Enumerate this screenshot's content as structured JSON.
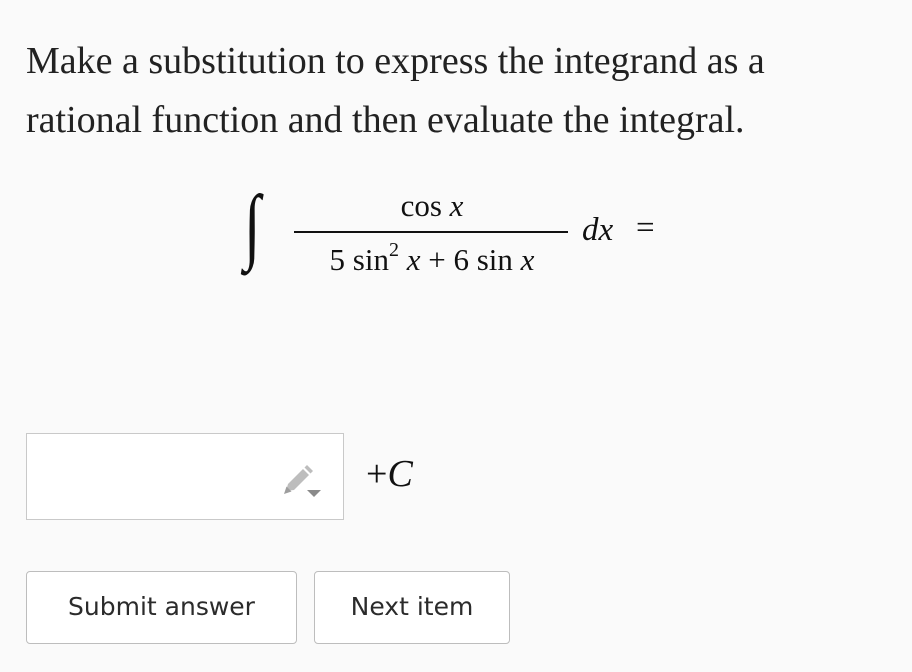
{
  "question": {
    "line1": "Make a substitution to express the integrand as a",
    "line2": "rational function and then evaluate the integral."
  },
  "math": {
    "integral_sign": "∫",
    "numerator": {
      "fn": "cos",
      "var": "x"
    },
    "denominator": {
      "coef1": "5",
      "fn1": "sin",
      "exponent": "2",
      "var1": "x",
      "plus": "+",
      "coef2": "6",
      "fn2": "sin",
      "var2": "x"
    },
    "differential": "dx",
    "equals": "="
  },
  "answer": {
    "value": "",
    "placeholder": "",
    "suffix_plus": "+",
    "suffix_constant": "C"
  },
  "icons": {
    "editor_icon": "pencil-dropdown-icon"
  },
  "buttons": {
    "submit_label": "Submit answer",
    "next_label": "Next item"
  }
}
